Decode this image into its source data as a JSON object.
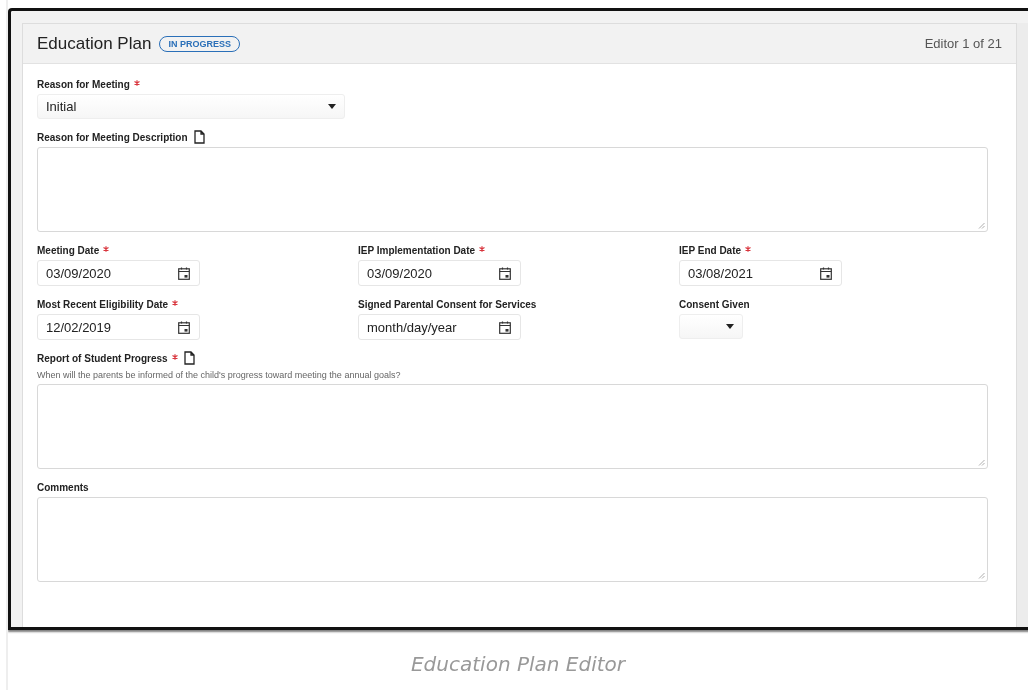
{
  "header": {
    "title": "Education Plan",
    "status": "IN PROGRESS",
    "counter": "Editor 1 of 21"
  },
  "rows": [
    {
      "fields": [
        {
          "kind": "select",
          "label": "Reason for Meeting",
          "required": true,
          "value": "Initial"
        }
      ]
    },
    {
      "fields": [
        {
          "kind": "textarea",
          "label": "Reason for Meeting Description",
          "note_icon": true
        }
      ]
    },
    {
      "fields": [
        {
          "kind": "date",
          "label": "Meeting Date",
          "required": true,
          "value": "03/09/2020"
        },
        {
          "kind": "date",
          "label": "IEP Implementation Date",
          "required": true,
          "value": "03/09/2020"
        },
        {
          "kind": "date",
          "label": "IEP End Date",
          "required": true,
          "value": "03/08/2021"
        }
      ]
    },
    {
      "fields": [
        {
          "kind": "date",
          "label": "Most Recent Eligibility Date",
          "required": true,
          "value": "12/02/2019"
        },
        {
          "kind": "date",
          "label": "Signed Parental Consent for Services",
          "placeholder": "month/day/year"
        },
        {
          "kind": "small_select",
          "label": "Consent Given"
        }
      ]
    },
    {
      "fields": [
        {
          "kind": "textarea",
          "label": "Report of Student Progress",
          "required": true,
          "note_icon": true,
          "hint": "When will the parents be informed of the child's progress toward meeting the annual goals?"
        }
      ]
    },
    {
      "fields": [
        {
          "kind": "textarea",
          "label": "Comments"
        }
      ]
    }
  ],
  "caption": "Education Plan Editor"
}
